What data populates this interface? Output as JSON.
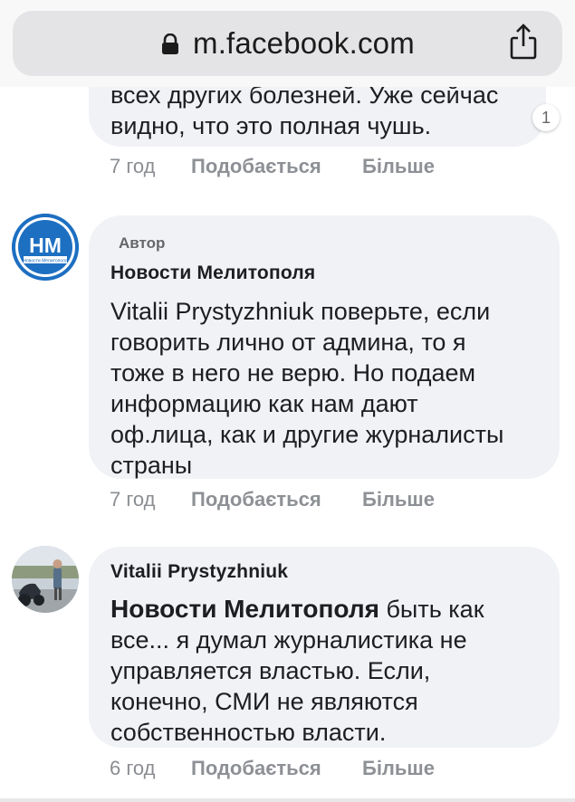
{
  "browser": {
    "url": "m.facebook.com"
  },
  "comments": [
    {
      "lines": [
        "всех других болезней. Уже сейчас",
        "видно, что это полная чушь."
      ],
      "reaction_count": "1",
      "time": "7 год",
      "like_label": "Подобається",
      "more_label": "Більше"
    },
    {
      "badge": "Автор",
      "author": "Новости Мелитополя",
      "avatar_initials": "НМ",
      "avatar_caption": "Новости Мелитополя",
      "lines": [
        "Vitalii Prystyzhniuk поверьте, если",
        "говорить лично от админа, то я",
        "тоже в него не верю. Но подаем",
        "информацию как нам дают",
        "оф.лица, как и другие журналисты",
        "страны"
      ],
      "time": "7 год",
      "like_label": "Подобається",
      "more_label": "Більше"
    },
    {
      "author": "Vitalii Prystyzhniuk",
      "mention": "Новости Мелитополя",
      "first_line_rest": " быть как",
      "lines": [
        "все... я думал журналистика не",
        "управляется властью. Если,",
        "конечно, СМИ не являются",
        "собственностью власти."
      ],
      "time": "6 год",
      "like_label": "Подобається",
      "more_label": "Більше"
    }
  ],
  "colors": {
    "bubble": "#f0f2f5",
    "avatar_blue": "#1d6fc1",
    "meta_gray": "#8a8d91"
  }
}
